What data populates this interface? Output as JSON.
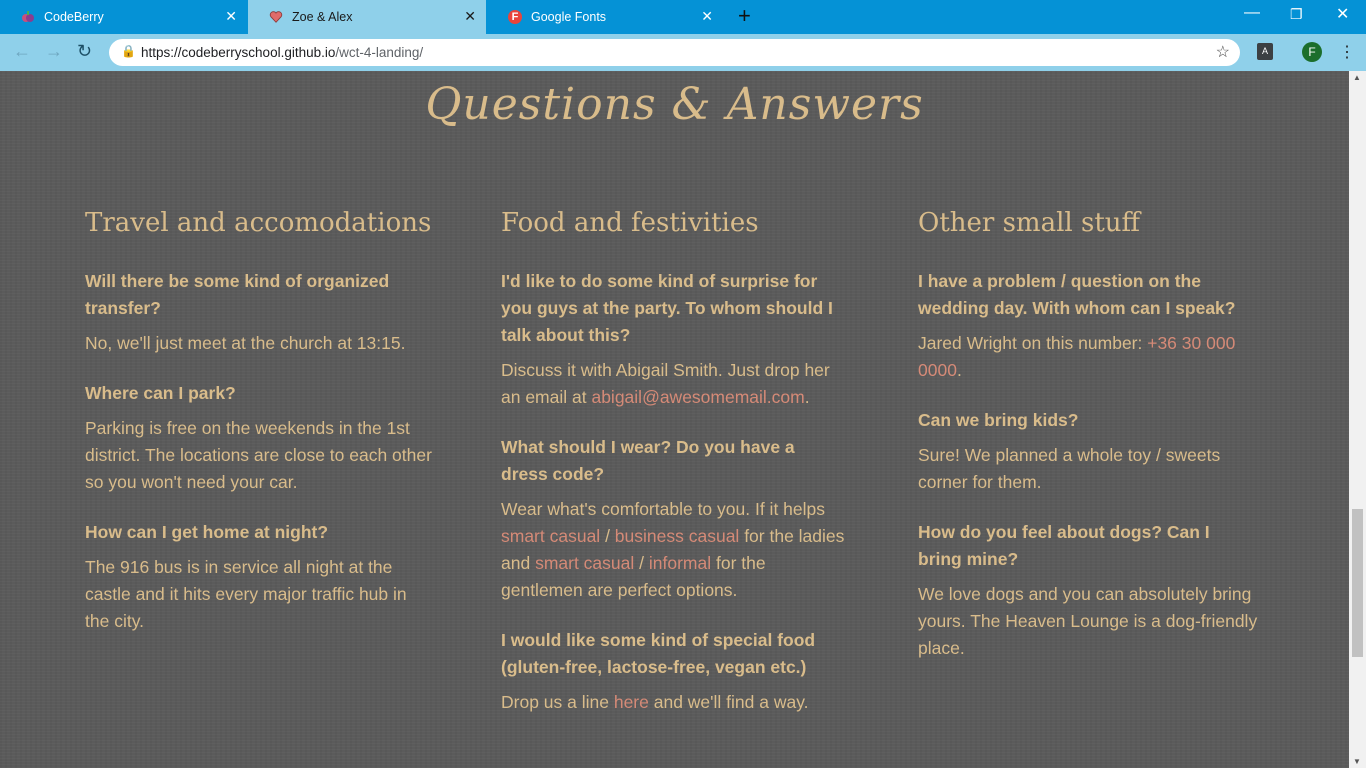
{
  "browser": {
    "tabs": [
      {
        "title": "CodeBerry",
        "active": false,
        "icon": "codeberry-favicon"
      },
      {
        "title": "Zoe & Alex",
        "active": true,
        "icon": "heart-favicon"
      },
      {
        "title": "Google Fonts",
        "active": false,
        "icon": "google-fonts-favicon"
      }
    ],
    "new_tab": "+",
    "url_host": "https://codeberryschool.github.io",
    "url_path": "/wct-4-landing/",
    "avatar_letter": "F",
    "accent": "#0592d6"
  },
  "page": {
    "title": "Questions & Answers",
    "title_color": "#d9bc8b",
    "link_color": "#d58a77",
    "columns": [
      {
        "heading": "Travel and accomodations",
        "items": [
          {
            "q": "Will there be some kind of organized transfer?",
            "a": "No, we'll just meet at the church at 13:15."
          },
          {
            "q": "Where can I park?",
            "a": "Parking is free on the weekends in the 1st district. The locations are close to each other so you won't need your car."
          },
          {
            "q": "How can I get home at night?",
            "a": "The 916 bus is in service all night at the castle and it hits every major traffic hub in the city."
          }
        ]
      },
      {
        "heading": "Food and festivities",
        "items": [
          {
            "q": "I'd like to do some kind of surprise for you guys at the party. To whom should I talk about this?",
            "a_pre": "Discuss it with Abigail Smith. Just drop her an email at ",
            "a_link": "abigail@awesomemail.com",
            "a_post": "."
          },
          {
            "q": "What should I wear? Do you have a dress code?",
            "a_1": "Wear what's comfortable to you. If it helps ",
            "l_1": "smart casual",
            "s_1": " / ",
            "l_2": "business casual",
            "a_2": " for the ladies and ",
            "l_3": "smart casual",
            "s_2": " / ",
            "l_4": "informal",
            "a_3": " for the gentlemen are perfect options."
          },
          {
            "q": "I would like some kind of special food (gluten-free, lactose-free, vegan etc.)",
            "a_pre": "Drop us a line ",
            "a_link": "here",
            "a_post": " and we'll find a way."
          }
        ]
      },
      {
        "heading": "Other small stuff",
        "items": [
          {
            "q": "I have a problem / question on the wedding day. With whom can I speak?",
            "a_pre": "Jared Wright on this number: ",
            "a_link": "+36 30 000 0000",
            "a_post": "."
          },
          {
            "q": "Can we bring kids?",
            "a": "Sure! We planned a whole toy / sweets corner for them."
          },
          {
            "q": "How do you feel about dogs? Can I bring mine?",
            "a": "We love dogs and you can absolutely bring yours. The Heaven Lounge is a dog-friendly place."
          }
        ]
      }
    ]
  }
}
